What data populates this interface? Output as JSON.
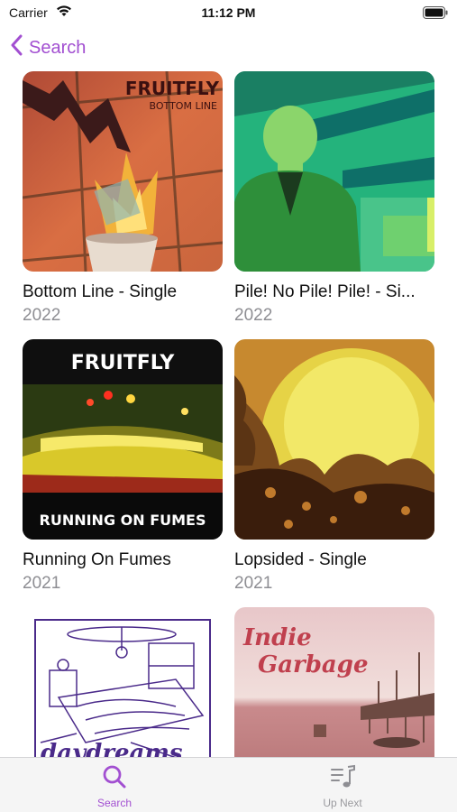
{
  "status_bar": {
    "carrier": "Carrier",
    "time": "11:12 PM"
  },
  "nav": {
    "back_label": "Search"
  },
  "albums": [
    {
      "title": "Bottom Line - Single",
      "year": "2022",
      "art_text": [
        "FRUITFLY",
        "BOTTOM LINE"
      ]
    },
    {
      "title": "Pile! No Pile! Pile! - Si...",
      "year": "2022"
    },
    {
      "title": "Running On Fumes",
      "year": "2021",
      "art_text": [
        "FRUITFLY",
        "RUNNING ON FUMES"
      ]
    },
    {
      "title": "Lopsided - Single",
      "year": "2021"
    },
    {
      "title": "",
      "year": "",
      "art_text": [
        "daydreams"
      ]
    },
    {
      "title": "",
      "year": "",
      "art_text": [
        "Indie",
        "Garbage"
      ]
    }
  ],
  "tabbar": {
    "items": [
      {
        "label": "Search",
        "icon": "search-icon",
        "active": true
      },
      {
        "label": "Up Next",
        "icon": "music-note-list-icon",
        "active": false
      }
    ]
  },
  "colors": {
    "accent": "#a24fd1",
    "secondary_text": "#8e8e93"
  }
}
